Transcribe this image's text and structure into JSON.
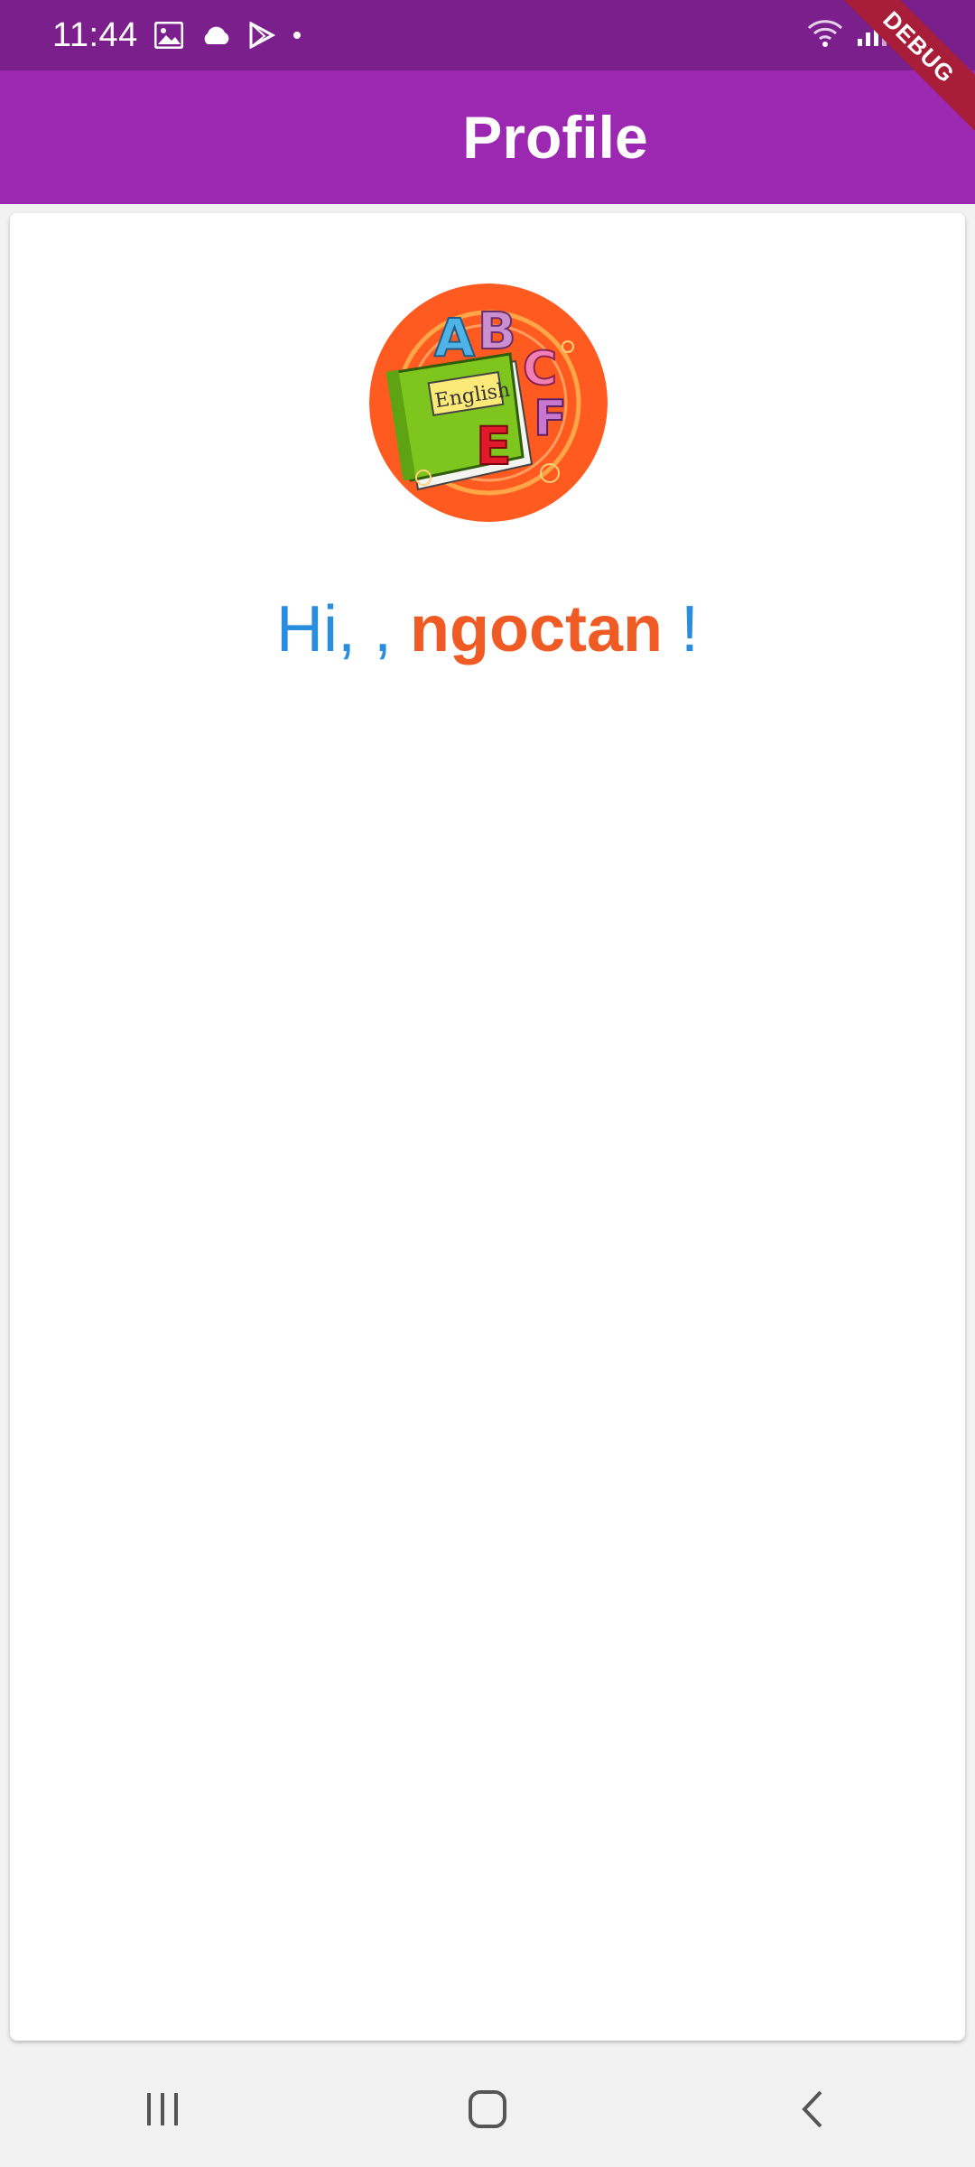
{
  "status_bar": {
    "time": "11:44",
    "debug_label": "DEBUG"
  },
  "app_bar": {
    "title": "Profile"
  },
  "profile": {
    "logo_text": "English",
    "greeting_prefix": "Hi, , ",
    "username": "ngoctan",
    "greeting_suffix": " !"
  },
  "colors": {
    "status_bar": "#7b1f8c",
    "app_bar": "#9c27b0",
    "greeting_blue": "#2a8ee0",
    "greeting_orange": "#f05a24"
  },
  "nav_bar": {
    "icons": [
      "recent-apps-icon",
      "home-icon",
      "back-icon"
    ]
  }
}
